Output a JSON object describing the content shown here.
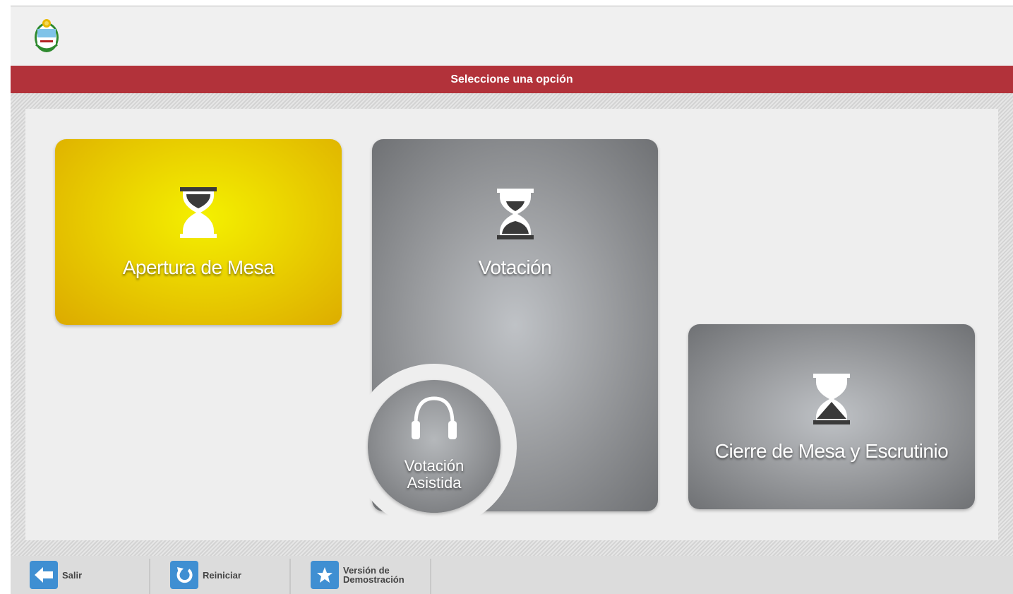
{
  "header": {
    "logo_name": "argentina-coat-of-arms",
    "title": "Seleccione una opción"
  },
  "tiles": {
    "apertura": {
      "label": "Apertura de Mesa",
      "color": "#ecd800",
      "icon": "hourglass-icon"
    },
    "votacion": {
      "label": "Votación",
      "color": "#9c9ea1",
      "icon": "hourglass-icon"
    },
    "cierre": {
      "label": "Cierre de Mesa y Escrutinio",
      "color": "#9c9ea1",
      "icon": "hourglass-icon"
    },
    "votacion_asistida": {
      "label_line1": "Votación",
      "label_line2": "Asistida",
      "icon": "headphones-icon"
    }
  },
  "footer": {
    "salir_label": "Salir",
    "reiniciar_label": "Reiniciar",
    "demo_label_line1": "Versión de",
    "demo_label_line2": "Demostración",
    "icon_color": "#3f8fd2"
  },
  "colors": {
    "title_bar": "#b2323a",
    "background": "#eeeeee"
  }
}
